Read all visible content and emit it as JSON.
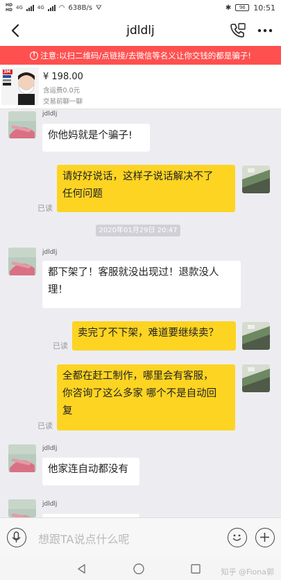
{
  "status": {
    "hd1": "HD",
    "hd2": "HD",
    "net1": "4G",
    "net2": "4G",
    "speed": "638B/s",
    "battery": "96",
    "time": "10:51"
  },
  "header": {
    "title": "jdldlj"
  },
  "warning": {
    "text": "注意:以扫二维码/点链接/去微信等名义让你交钱的都是骗子!"
  },
  "product": {
    "price": "¥ 198.00",
    "shipping": "含运费0.0元",
    "state": "交易前聊一聊",
    "thumb_brand": "3M"
  },
  "messages": [
    {
      "sender": "jdldlj",
      "text": "你他妈就是个骗子!"
    },
    {
      "text_line1": "请好好说话，这样子说话解决不了",
      "text_line2": "任何问题",
      "status": "已读"
    },
    {
      "timestamp": "2020年01月29日 20:47"
    },
    {
      "sender": "jdldlj",
      "text_line1": "都下架了！客服就没出现过！退款没人",
      "text_line2": "理！"
    },
    {
      "text": "卖完了不下架，难道要继续卖？",
      "status": "已读"
    },
    {
      "text_line1": "全都在赶工制作，哪里会有客服，",
      "text_line2": "你咨询了这么多家 哪个不是自动回",
      "text_line3": "复",
      "status": "已读"
    },
    {
      "sender": "jdldlj",
      "text": "他家连自动都没有"
    },
    {
      "sender": "jdldlj"
    }
  ],
  "input": {
    "placeholder": "想跟TA说点什么呢"
  },
  "watermark": "知乎 @Fiona郭",
  "colors": {
    "warning_bg": "#ff5050",
    "outgoing_bubble": "#fdd422",
    "incoming_bubble": "#ffffff",
    "chat_bg": "#ededf1"
  }
}
